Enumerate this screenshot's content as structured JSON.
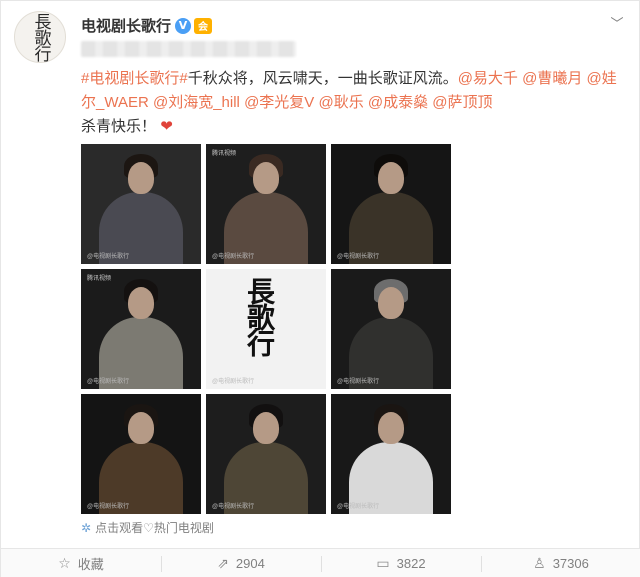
{
  "account": {
    "avatar_text": "長歌行",
    "username": "电视剧长歌行",
    "verified_badge": "V",
    "member_badge": "会"
  },
  "post": {
    "hashtag": "#电视剧长歌行#",
    "text_1": "千秋众将，风云啸天，一曲长歌证风流。",
    "mentions": [
      "@易大千",
      "@曹曦月",
      "@娃",
      "尔_WAER",
      "@刘海宽_hill",
      "@李光复V",
      "@耿乐",
      "@成泰燊",
      "@萨顶顶"
    ],
    "text_2": "杀青快乐！",
    "heart": "❤"
  },
  "images": {
    "watermark": "@电视剧长歌行",
    "tile_logo": "腾讯视频",
    "title_calligraphy": "長歌行",
    "tiles": [
      {
        "tone": "#2a2a2a",
        "body": "#4a4a52",
        "hair": "#1c1612"
      },
      {
        "tone": "#1e1e1e",
        "body": "#5a4a40",
        "hair": "#3a2a22"
      },
      {
        "tone": "#151515",
        "body": "#3a3328",
        "hair": "#0e0c0a"
      },
      {
        "tone": "#1b1b1b",
        "body": "#7c7a72",
        "hair": "#141110"
      },
      {
        "tone": "#f2f2f2",
        "body": "",
        "hair": ""
      },
      {
        "tone": "#1a1a1a",
        "body": "#30302e",
        "hair": "#6d6d6d"
      },
      {
        "tone": "#141414",
        "body": "#4d3a28",
        "hair": "#1a1512"
      },
      {
        "tone": "#1d1d1d",
        "body": "#4e4636",
        "hair": "#121010"
      },
      {
        "tone": "#181818",
        "body": "#d9d9d9",
        "hair": "#1a1512"
      }
    ]
  },
  "video_link": {
    "icon": "video-icon",
    "label": "点击观看♡热门电视剧"
  },
  "actions": {
    "favorite_label": "收藏",
    "repost_count": "2904",
    "comment_count": "3822",
    "like_count": "37306"
  },
  "colors": {
    "link": "#eb7350",
    "verified": "#4a9ff5",
    "heart": "#e0433a"
  }
}
